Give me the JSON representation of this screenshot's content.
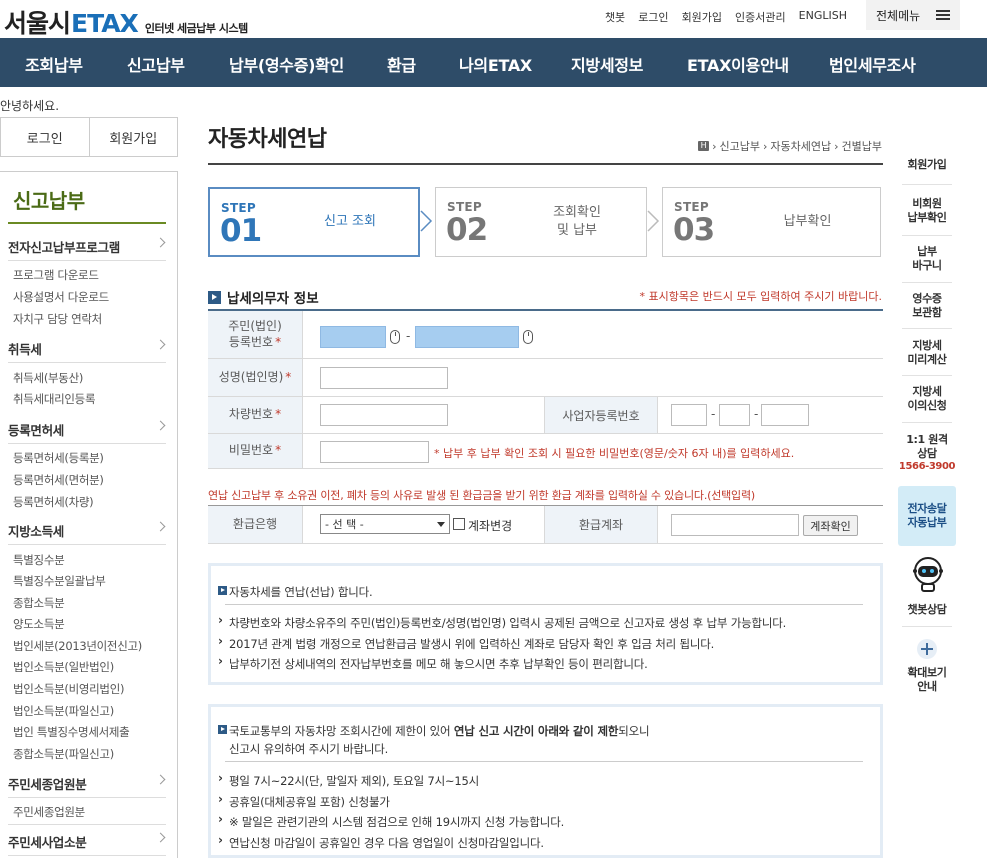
{
  "header": {
    "logo_kr": "서울시",
    "logo_en": "ETAX",
    "logo_sub": "인터넷 세금납부 시스템",
    "util_links": [
      "챗봇",
      "로그인",
      "회원가입",
      "인증서관리",
      "ENGLISH"
    ],
    "all_menu": "전체메뉴"
  },
  "nav": [
    "조회납부",
    "신고납부",
    "납부(영수증)확인",
    "환급",
    "나의ETAX",
    "지방세정보",
    "ETAX이용안내",
    "법인세무조사"
  ],
  "greeting": "안녕하세요.",
  "login": {
    "login_label": "로그인",
    "join_label": "회원가입"
  },
  "sidebar": {
    "title": "신고납부",
    "cats": [
      {
        "label": "전자신고납부프로그램",
        "subs": [
          "프로그램 다운로드",
          "사용설명서 다운로드",
          "자치구 담당 연락처"
        ]
      },
      {
        "label": "취득세",
        "subs": [
          "취득세(부동산)",
          "취득세대리인등록"
        ]
      },
      {
        "label": "등록면허세",
        "subs": [
          "등록면허세(등록분)",
          "등록면허세(면허분)",
          "등록면허세(차량)"
        ]
      },
      {
        "label": "지방소득세",
        "subs": [
          "특별징수분",
          "특별징수분일괄납부",
          "종합소득분",
          "양도소득분",
          "법인세분(2013년이전신고)",
          "법인소득분(일반법인)",
          "법인소득분(비영리법인)",
          "법인소득분(파일신고)",
          "법인 특별징수명세서제출",
          "종합소득분(파일신고)"
        ]
      },
      {
        "label": "주민세종업원분",
        "subs": [
          "주민세종업원분"
        ]
      },
      {
        "label": "주민세사업소분",
        "subs": []
      }
    ]
  },
  "main": {
    "title": "자동차세연납",
    "breadcrumb": [
      "신고납부",
      "자동차세연납",
      "건별납부"
    ],
    "home_badge": "H",
    "steps": [
      {
        "label": "STEP",
        "num": "01",
        "text": "신고 조회"
      },
      {
        "label": "STEP",
        "num": "02",
        "text_line1": "조회확인",
        "text_line2": "및 납부"
      },
      {
        "label": "STEP",
        "num": "03",
        "text": "납부확인"
      }
    ],
    "section_title": "납세의무자 정보",
    "required_note": "* 표시항목은 반드시 모두 입력하여 주시기 바랍니다.",
    "form": {
      "rrn_label_1": "주민(법인)",
      "rrn_label_2": "등록번호",
      "name_label": "성명(법인명)",
      "car_label": "차량번호",
      "biz_label": "사업자등록번호",
      "pw_label": "비밀번호",
      "pw_note": "* 납부 후 납부 확인 조회 시 필요한 비밀번호(영문/숫자 6자 내)를 입력하세요.",
      "star": "*",
      "dash": "-"
    },
    "refund_note": "연납 신고납부 후 소유권 이전, 폐차 등의 사유로 발생 된 환급금을 받기 위한 환급 계좌를 입력하실 수 있습니다.(선택입력)",
    "refund": {
      "bank_label": "환급은행",
      "bank_select": "- 선 택 -",
      "change_label": "계좌변경",
      "account_label": "환급계좌",
      "check_button": "계좌확인"
    },
    "info_box_1": {
      "head": "자동차세를 연납(선납) 합니다.",
      "items": [
        "차량번호와 차량소유주의 주민(법인)등록번호/성명(법인명) 입력시 공제된 금액으로 신고자료 생성 후 납부 가능합니다.",
        "2017년 관계 법령 개정으로 연납환급금 발생시 위에 입력하신 계좌로 담당자 확인 후 입금 처리 됩니다.",
        "납부하기전 상세내역의 전자납부번호를 메모 해 놓으시면 추후 납부확인 등이 편리합니다."
      ]
    },
    "info_box_2": {
      "head_a": "국토교통부의 자동차망 조회시간에 제한이 있어 ",
      "head_b": "연납 신고 시간이 아래와 같이 제한",
      "head_c": "되오니",
      "head_line2": "신고시 유의하여 주시기 바랍니다.",
      "items": [
        "평일 7시~22시(단, 말일자 제외), 토요일 7시~15시",
        "공휴일(대체공휴일 포함) 신청불가",
        "※ 말일은 관련기관의 시스템 점검으로 인해 19시까지 신청 가능합니다.",
        "연납신청 마감일이 공휴일인 경우 다음 영업일이 신청마감일입니다."
      ]
    }
  },
  "quick": {
    "items": [
      [
        "회원가입"
      ],
      [
        "비회원",
        "납부확인"
      ],
      [
        "납부",
        "바구니"
      ],
      [
        "영수증",
        "보관함"
      ],
      [
        "지방세",
        "미리계산"
      ],
      [
        "지방세",
        "이의신청"
      ]
    ],
    "tel_line1": "1:1 원격",
    "tel_line2": "상담",
    "tel_no": "1566-3900",
    "highlight": [
      "전자송달",
      "자동납부"
    ],
    "chatbot": "챗봇상담",
    "zoom": [
      "확대보기",
      "안내"
    ]
  },
  "colors": {
    "nav_bg": "#2e4c68",
    "accent_blue": "#2f76b8",
    "side_green": "#4b6b16",
    "warn_red": "#c0392b"
  }
}
